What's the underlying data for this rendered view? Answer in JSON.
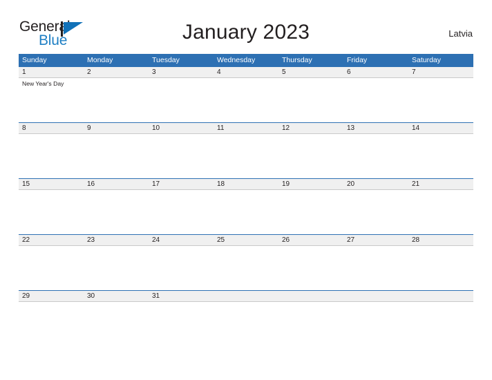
{
  "brand": {
    "name_part1": "General",
    "name_part2": "Blue",
    "mark_icon": "flag-triangle-icon",
    "accent_color": "#1272b8",
    "text_color": "#231f20"
  },
  "header": {
    "title": "January 2023",
    "region": "Latvia"
  },
  "calendar": {
    "header_bg": "#2d70b3",
    "band_bg": "#f0f0f0",
    "weekdays": [
      "Sunday",
      "Monday",
      "Tuesday",
      "Wednesday",
      "Thursday",
      "Friday",
      "Saturday"
    ],
    "weeks": [
      {
        "days": [
          {
            "number": "1",
            "events": [
              "New Year's Day"
            ]
          },
          {
            "number": "2",
            "events": []
          },
          {
            "number": "3",
            "events": []
          },
          {
            "number": "4",
            "events": []
          },
          {
            "number": "5",
            "events": []
          },
          {
            "number": "6",
            "events": []
          },
          {
            "number": "7",
            "events": []
          }
        ]
      },
      {
        "days": [
          {
            "number": "8",
            "events": []
          },
          {
            "number": "9",
            "events": []
          },
          {
            "number": "10",
            "events": []
          },
          {
            "number": "11",
            "events": []
          },
          {
            "number": "12",
            "events": []
          },
          {
            "number": "13",
            "events": []
          },
          {
            "number": "14",
            "events": []
          }
        ]
      },
      {
        "days": [
          {
            "number": "15",
            "events": []
          },
          {
            "number": "16",
            "events": []
          },
          {
            "number": "17",
            "events": []
          },
          {
            "number": "18",
            "events": []
          },
          {
            "number": "19",
            "events": []
          },
          {
            "number": "20",
            "events": []
          },
          {
            "number": "21",
            "events": []
          }
        ]
      },
      {
        "days": [
          {
            "number": "22",
            "events": []
          },
          {
            "number": "23",
            "events": []
          },
          {
            "number": "24",
            "events": []
          },
          {
            "number": "25",
            "events": []
          },
          {
            "number": "26",
            "events": []
          },
          {
            "number": "27",
            "events": []
          },
          {
            "number": "28",
            "events": []
          }
        ]
      },
      {
        "days": [
          {
            "number": "29",
            "events": []
          },
          {
            "number": "30",
            "events": []
          },
          {
            "number": "31",
            "events": []
          },
          {
            "number": "",
            "events": []
          },
          {
            "number": "",
            "events": []
          },
          {
            "number": "",
            "events": []
          },
          {
            "number": "",
            "events": []
          }
        ]
      }
    ]
  }
}
